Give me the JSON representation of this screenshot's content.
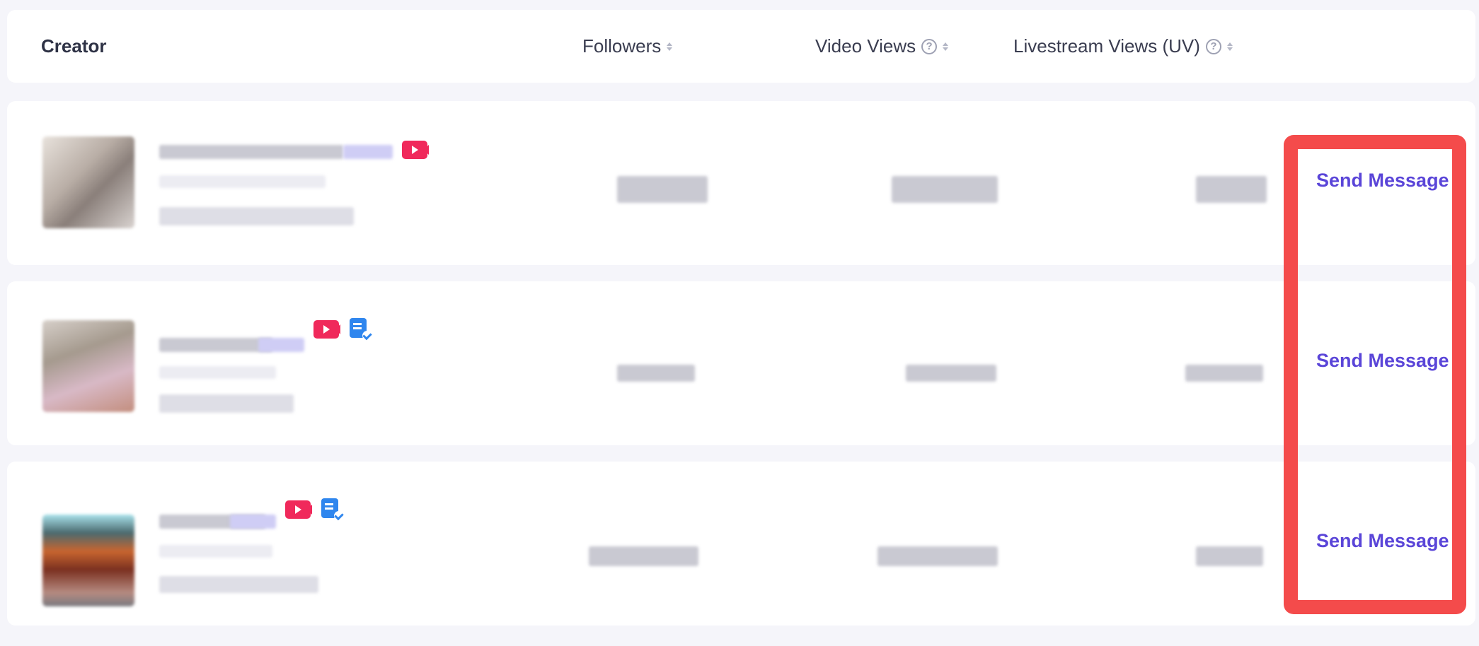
{
  "table": {
    "columns": {
      "creator": "Creator",
      "followers": "Followers",
      "video_views": "Video Views",
      "livestream_views": "Livestream Views (UV)"
    },
    "rows": [
      {
        "action_label": "Send Message",
        "badges": [
          "video-live-icon"
        ]
      },
      {
        "action_label": "Send Message",
        "badges": [
          "video-live-icon",
          "verified-document-icon"
        ]
      },
      {
        "action_label": "Send Message",
        "badges": [
          "video-live-icon",
          "verified-document-icon"
        ]
      }
    ]
  },
  "colors": {
    "accent": "#5a45d8",
    "highlight": "#f44b4b",
    "video_badge": "#f0295b",
    "doc_badge": "#2f86ee"
  }
}
